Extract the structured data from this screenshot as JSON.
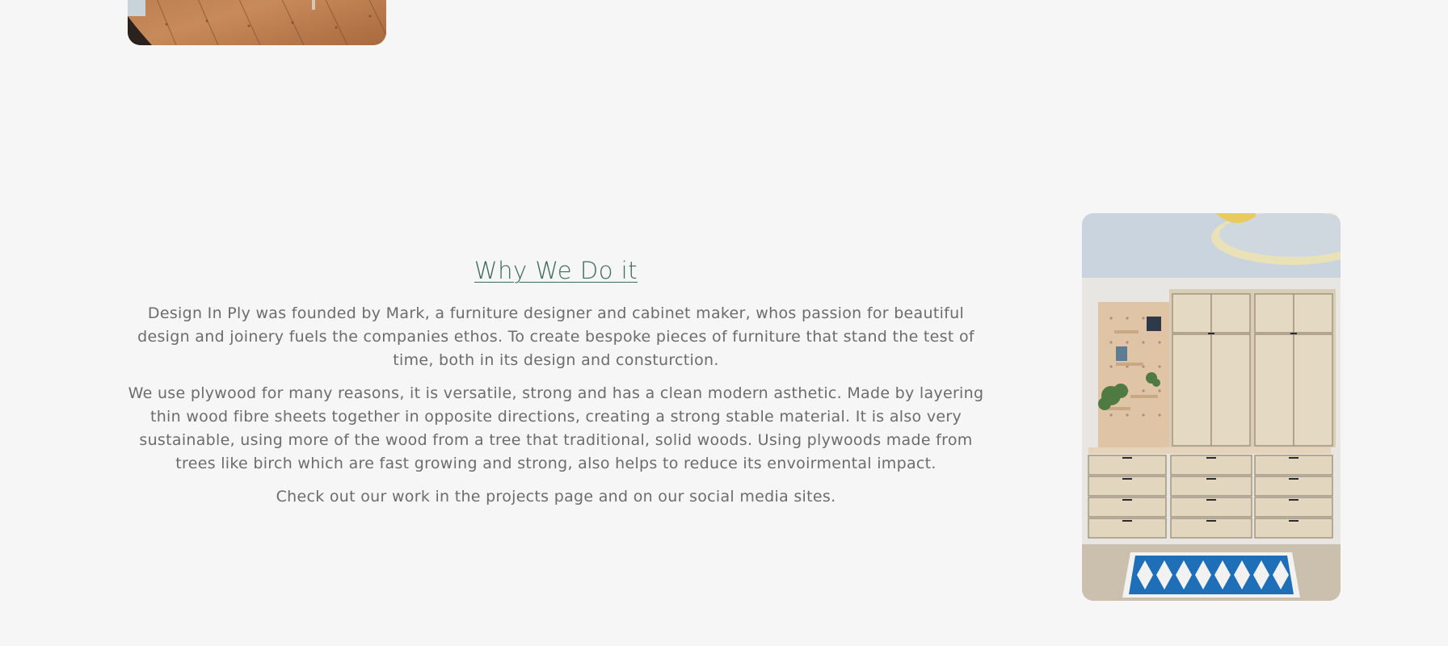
{
  "section": {
    "title": "Why We Do it",
    "paragraphs": [
      "Design In Ply was founded by Mark, a furniture designer and cabinet maker, whos passion for beautiful design and joinery fuels the companies ethos. To create bespoke pieces of furniture that stand the test of time, both in its design and consturction.",
      "We use plywood for many reasons, it is versatile, strong and has a clean modern asthetic. Made by layering thin wood fibre sheets together in opposite directions, creating a strong stable material. It is also very sustainable, using more of the wood from a tree that traditional, solid woods. Using plywoods made from trees like birch which are fast growing and strong, also helps to reduce its envoirmental impact.",
      "Check out our work in the projects page and on our social media sites."
    ]
  },
  "colors": {
    "background": "#f6f6f6",
    "title": "#3f6b5b",
    "body_text": "#6c6c6c"
  }
}
